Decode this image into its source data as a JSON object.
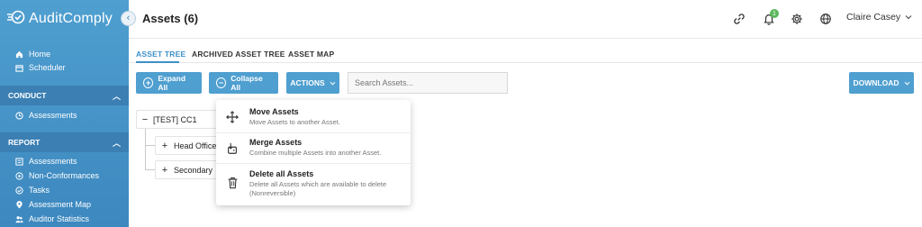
{
  "brand": {
    "name": "AuditComply"
  },
  "sidebar": {
    "top_items": [
      {
        "label": "Home",
        "icon": "home-icon"
      },
      {
        "label": "Scheduler",
        "icon": "calendar-icon"
      }
    ],
    "sections": [
      {
        "title": "CONDUCT",
        "items": [
          {
            "label": "Assessments",
            "icon": "clock-icon"
          }
        ]
      },
      {
        "title": "REPORT",
        "items": [
          {
            "label": "Assessments",
            "icon": "list-icon"
          },
          {
            "label": "Non-Conformances",
            "icon": "nonconformance-icon"
          },
          {
            "label": "Tasks",
            "icon": "tasks-icon"
          },
          {
            "label": "Assessment Map",
            "icon": "map-pin-icon"
          },
          {
            "label": "Auditor Statistics",
            "icon": "users-icon"
          }
        ]
      }
    ]
  },
  "header": {
    "title": "Assets (6)",
    "notification_count": "1",
    "user_name": "Claire Casey"
  },
  "tabs": [
    {
      "label": "ASSET TREE",
      "active": true
    },
    {
      "label": "ARCHIVED ASSET TREE",
      "active": false
    },
    {
      "label": "ASSET MAP",
      "active": false
    }
  ],
  "toolbar": {
    "expand_label": "Expand All",
    "collapse_label": "Collapse All",
    "actions_label": "ACTIONS",
    "search_placeholder": "Search Assets...",
    "download_label": "DOWNLOAD"
  },
  "tree": {
    "root": {
      "label": "[TEST] CC1"
    },
    "children": [
      {
        "label": "Head Office"
      },
      {
        "label": "Secondary"
      }
    ]
  },
  "actions_menu": [
    {
      "title": "Move Assets",
      "description": "Move Assets to another Asset.",
      "icon": "move-icon"
    },
    {
      "title": "Merge Assets",
      "description": "Combine multiple Assets into another Asset.",
      "icon": "merge-icon"
    },
    {
      "title": "Delete all Assets",
      "description": "Delete all Assets which are available to delete (Nonreversible)",
      "icon": "trash-icon"
    }
  ],
  "colors": {
    "primary": "#4f9fd0",
    "highlight_border": "#e4574a",
    "badge": "#5cb85c"
  }
}
